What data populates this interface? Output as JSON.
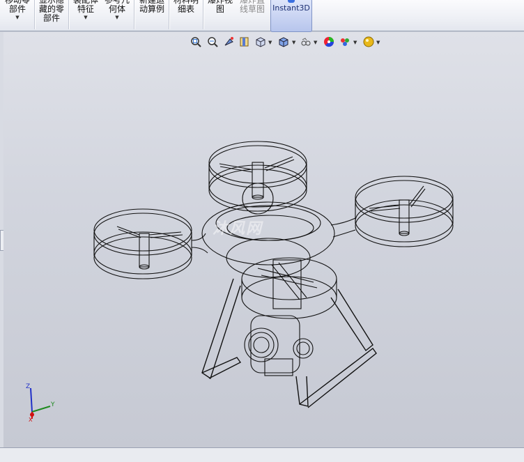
{
  "ribbon": {
    "move_component": "移动零\n部件",
    "show_hidden": "显示隐\n藏的零\n部件",
    "assembly_feature": "装配体\n特征",
    "reference_geometry": "参考几\n何体",
    "new_motion_study": "新建运\n动算例",
    "bom": "材料明\n细表",
    "exploded_view": "爆炸视\n图",
    "explode_line_sketch": "爆炸直\n线草图",
    "instant3d": "Instant3D"
  },
  "heads_up_toolbar": {
    "icons": [
      "zoom-to-fit-icon",
      "zoom-to-area-icon",
      "previous-view-icon",
      "section-view-icon",
      "view-orientation-icon",
      "display-style-icon",
      "hide-show-items-icon",
      "edit-appearance-icon",
      "apply-scene-icon",
      "view-settings-icon"
    ]
  },
  "watermark": "沐风网",
  "triad": {
    "x": "X",
    "y": "Y",
    "z": "Z"
  },
  "colors": {
    "viewport_top": "#dfe1e8",
    "viewport_bottom": "#c6c9d3",
    "instant3d_active": "#b7c5ec",
    "triad_x": "#1e8a1e",
    "triad_y": "#1e8a1e",
    "triad_z": "#2030c8",
    "triad_origin": "#d01010"
  }
}
